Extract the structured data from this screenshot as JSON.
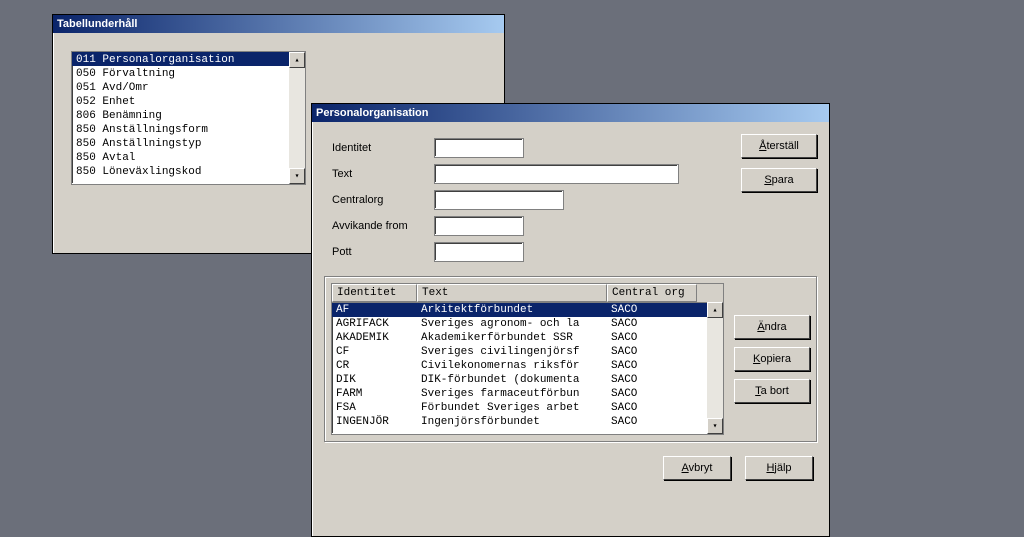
{
  "window1": {
    "title": "Tabellunderhåll",
    "items": [
      {
        "code": "011",
        "label": "Personalorganisation",
        "selected": true
      },
      {
        "code": "050",
        "label": "Förvaltning"
      },
      {
        "code": "051",
        "label": "Avd/Omr"
      },
      {
        "code": "052",
        "label": "Enhet"
      },
      {
        "code": "806",
        "label": "Benämning"
      },
      {
        "code": "850",
        "label": "Anställningsform"
      },
      {
        "code": "850",
        "label": "Anställningstyp"
      },
      {
        "code": "850",
        "label": "Avtal"
      },
      {
        "code": "850",
        "label": "Löneväxlingskod"
      }
    ]
  },
  "window2": {
    "title": "Personalorganisation",
    "fields": {
      "identitet": "Identitet",
      "text": "Text",
      "centralorg": "Centralorg",
      "avvikande": "Avvikande from",
      "pott": "Pott"
    },
    "buttons": {
      "aterstall": "Återställ",
      "spara": "Spara",
      "andra": "Ändra",
      "kopiera": "Kopiera",
      "tabort": "Ta bort",
      "avbryt": "Avbryt",
      "hjalp": "Hjälp"
    },
    "grid": {
      "headers": {
        "id": "Identitet",
        "text": "Text",
        "org": "Central org"
      },
      "rows": [
        {
          "id": "AF",
          "text": "Arkitektförbundet",
          "org": "SACO",
          "selected": true
        },
        {
          "id": "AGRIFACK",
          "text": "Sveriges agronom- och la",
          "org": "SACO"
        },
        {
          "id": "AKADEMIK",
          "text": "Akademikerförbundet SSR",
          "org": "SACO"
        },
        {
          "id": "CF",
          "text": "Sveriges civilingenjörsf",
          "org": "SACO"
        },
        {
          "id": "CR",
          "text": "Civilekonomernas riksför",
          "org": "SACO"
        },
        {
          "id": "DIK",
          "text": "DIK-förbundet (dokumenta",
          "org": "SACO"
        },
        {
          "id": "FARM",
          "text": "Sveriges farmaceutförbun",
          "org": "SACO"
        },
        {
          "id": "FSA",
          "text": "Förbundet Sveriges arbet",
          "org": "SACO"
        },
        {
          "id": "INGENJÖR",
          "text": "Ingenjörsförbundet",
          "org": "SACO"
        }
      ]
    }
  }
}
